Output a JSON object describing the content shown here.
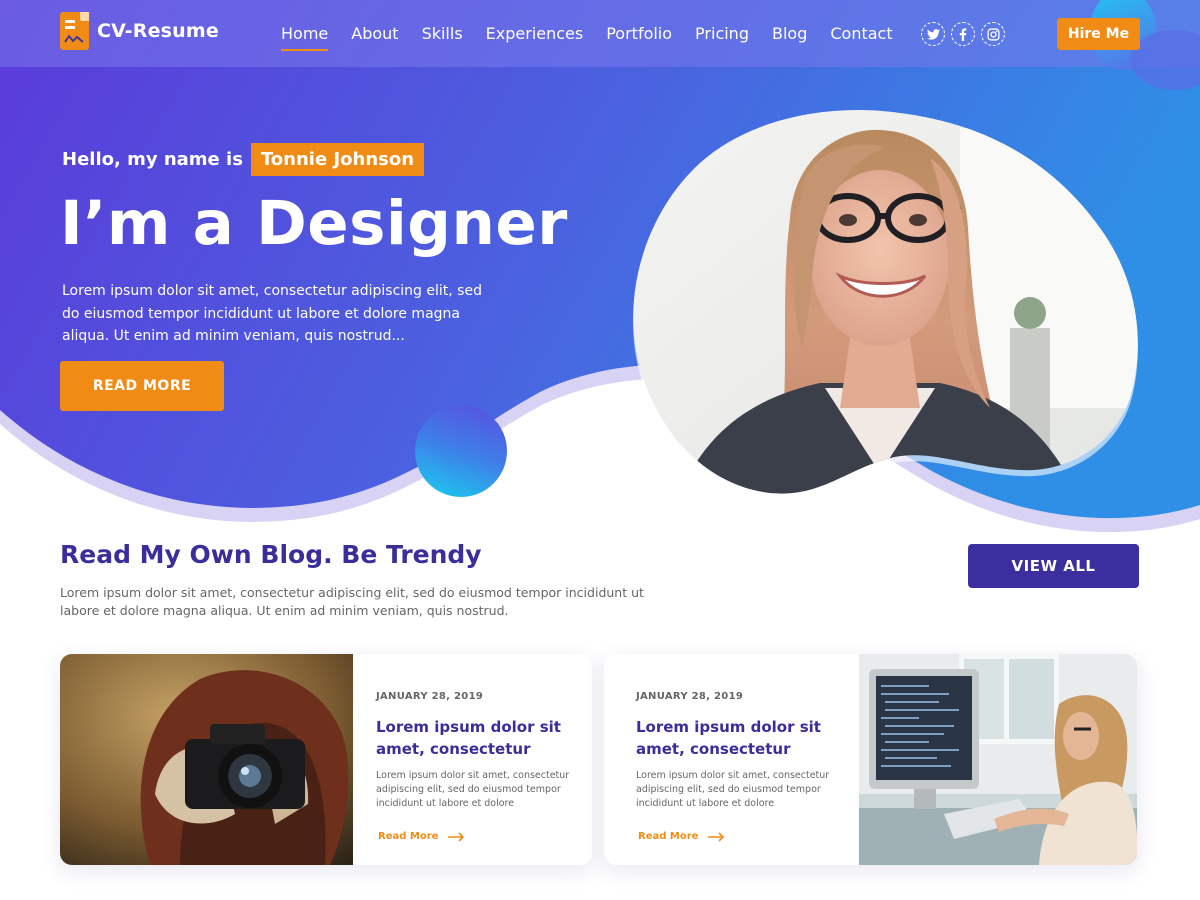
{
  "brand": {
    "name": "CV-Resume"
  },
  "nav": {
    "items": [
      "Home",
      "About",
      "Skills",
      "Experiences",
      "Portfolio",
      "Pricing",
      "Blog",
      "Contact"
    ],
    "active": "Home"
  },
  "social": [
    "twitter-icon",
    "facebook-icon",
    "instagram-icon"
  ],
  "header": {
    "cta_label": "Hire Me"
  },
  "hero": {
    "greeting": "Hello, my name is",
    "name": "Tonnie Johnson",
    "title": "I’m a Designer",
    "text": "Lorem ipsum dolor sit amet, consectetur adipiscing elit, sed do eiusmod tempor incididunt ut labore et dolore magna aliqua. Ut enim ad minim veniam, quis nostrud...",
    "button": "READ MORE"
  },
  "blog": {
    "title": "Read My Own Blog. Be Trendy",
    "description": "Lorem ipsum dolor sit amet, consectetur adipiscing elit, sed do eiusmod tempor incididunt ut labore et dolore magna aliqua. Ut enim ad minim veniam, quis nostrud.",
    "view_all": "VIEW ALL",
    "posts": [
      {
        "date": "JANUARY 28, 2019",
        "title": "Lorem ipsum dolor sit amet, consectetur",
        "excerpt": "Lorem ipsum dolor sit amet, consectetur adipiscing elit, sed do eiusmod tempor incididunt ut labore et dolore",
        "link": "Read More"
      },
      {
        "date": "JANUARY 28, 2019",
        "title": "Lorem ipsum dolor sit amet, consectetur",
        "excerpt": "Lorem ipsum dolor sit amet, consectetur adipiscing elit, sed do eiusmod tempor incididunt ut labore et dolore",
        "link": "Read More"
      }
    ]
  },
  "colors": {
    "accent": "#f08c15",
    "primary": "#3b2f9f",
    "hero_gradient_start": "#5b3ad9",
    "hero_gradient_end": "#2f8fe6"
  }
}
